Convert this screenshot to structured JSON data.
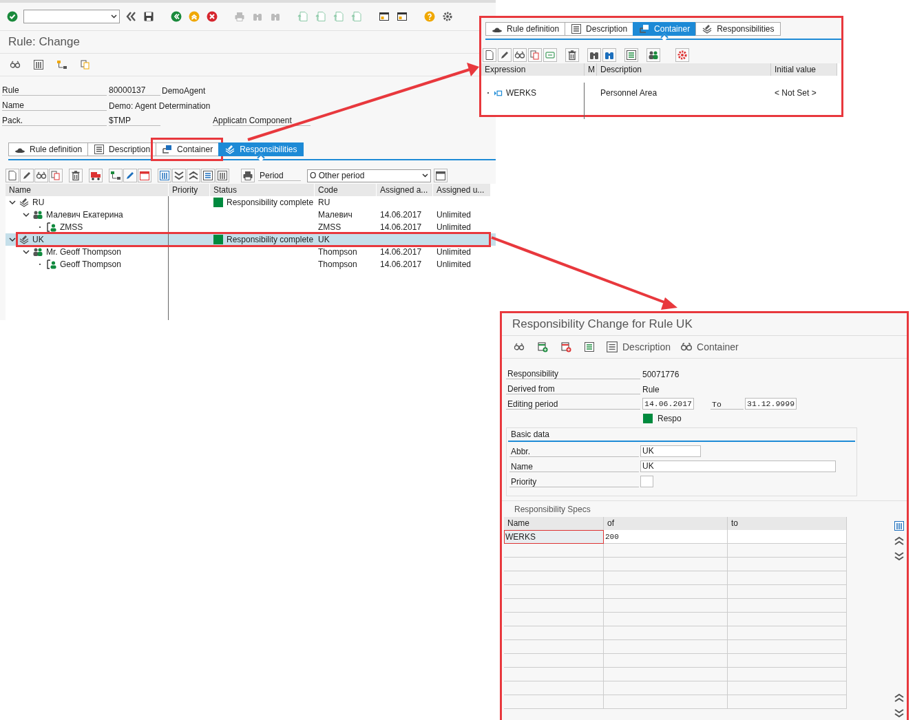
{
  "main": {
    "title": "Rule: Change",
    "fields": [
      {
        "label": "Rule",
        "value": "80000137",
        "extra": "DemoAgent"
      },
      {
        "label": "Name",
        "value": "Demo: Agent Determination"
      },
      {
        "label": "Pack.",
        "value": "$TMP",
        "extra_label": "Applicatn Component"
      }
    ],
    "tabs": [
      {
        "label": "Rule definition",
        "selected": false,
        "annotated": false
      },
      {
        "label": "Description",
        "selected": false,
        "annotated": false
      },
      {
        "label": "Container",
        "selected": false,
        "annotated": true
      },
      {
        "label": "Responsibilities",
        "selected": true,
        "annotated": false
      }
    ],
    "period": {
      "label": "Period",
      "value": "O Other period"
    },
    "columns": [
      "Name",
      "Priority",
      "Status",
      "Code",
      "Assigned a...",
      "Assigned u..."
    ],
    "tree": [
      {
        "kind": "responsibility",
        "name": "RU",
        "status": "Responsibility complete",
        "color": "#008a3e",
        "code": "RU",
        "expanded": true,
        "selected": false,
        "children": [
          {
            "kind": "group",
            "name": "Малевич Екатерина",
            "code": "Малевич",
            "from": "14.06.2017",
            "until": "Unlimited",
            "expanded": true,
            "selected": false,
            "children": [
              {
                "kind": "person",
                "name": "ZMSS",
                "code": "ZMSS",
                "from": "14.06.2017",
                "until": "Unlimited",
                "selected": false
              }
            ]
          }
        ]
      },
      {
        "kind": "responsibility",
        "name": "UK",
        "status": "Responsibility complete",
        "color": "#008a3e",
        "code": "UK",
        "expanded": true,
        "selected": true,
        "annotated": true,
        "children": [
          {
            "kind": "group",
            "name": "Mr. Geoff Thompson",
            "code": "Thompson",
            "from": "14.06.2017",
            "until": "Unlimited",
            "expanded": true,
            "selected": false,
            "children": [
              {
                "kind": "person",
                "name": "Geoff Thompson",
                "code": "Thompson",
                "from": "14.06.2017",
                "until": "Unlimited",
                "selected": false
              }
            ]
          }
        ]
      }
    ]
  },
  "container_view": {
    "tabs": [
      {
        "label": "Rule definition",
        "selected": false
      },
      {
        "label": "Description",
        "selected": false
      },
      {
        "label": "Container",
        "selected": true
      },
      {
        "label": "Responsibilities",
        "selected": false
      }
    ],
    "columns": [
      "Expression",
      "M",
      "Description",
      "Initial value"
    ],
    "rows": [
      {
        "expression": "WERKS",
        "description": "Personnel Area",
        "initial_value": "< Not Set >"
      }
    ]
  },
  "responsibility_dialog": {
    "title": "Responsibility Change for Rule UK",
    "toolbar": [
      "Description",
      "Container"
    ],
    "fields": [
      {
        "kind": "text",
        "label": "Responsibility",
        "value": "50071776"
      },
      {
        "kind": "text",
        "label": "Derived from",
        "value": "Rule"
      },
      {
        "kind": "range",
        "label": "Editing period",
        "value": "14.06.2017",
        "to_label": "To",
        "to_value": "31.12.9999"
      }
    ],
    "status": {
      "text": "Respo",
      "color": "#008a3e"
    },
    "basic_data": {
      "title": "Basic data",
      "fields": [
        {
          "label": "Abbr.",
          "value": "UK"
        },
        {
          "label": "Name",
          "value": "UK"
        },
        {
          "label": "Priority"
        }
      ]
    },
    "specs": {
      "title": "Responsibility Specs",
      "columns": [
        "Name",
        "of",
        "to"
      ],
      "rows": [
        {
          "name": "WERKS",
          "of": "200"
        }
      ]
    }
  }
}
